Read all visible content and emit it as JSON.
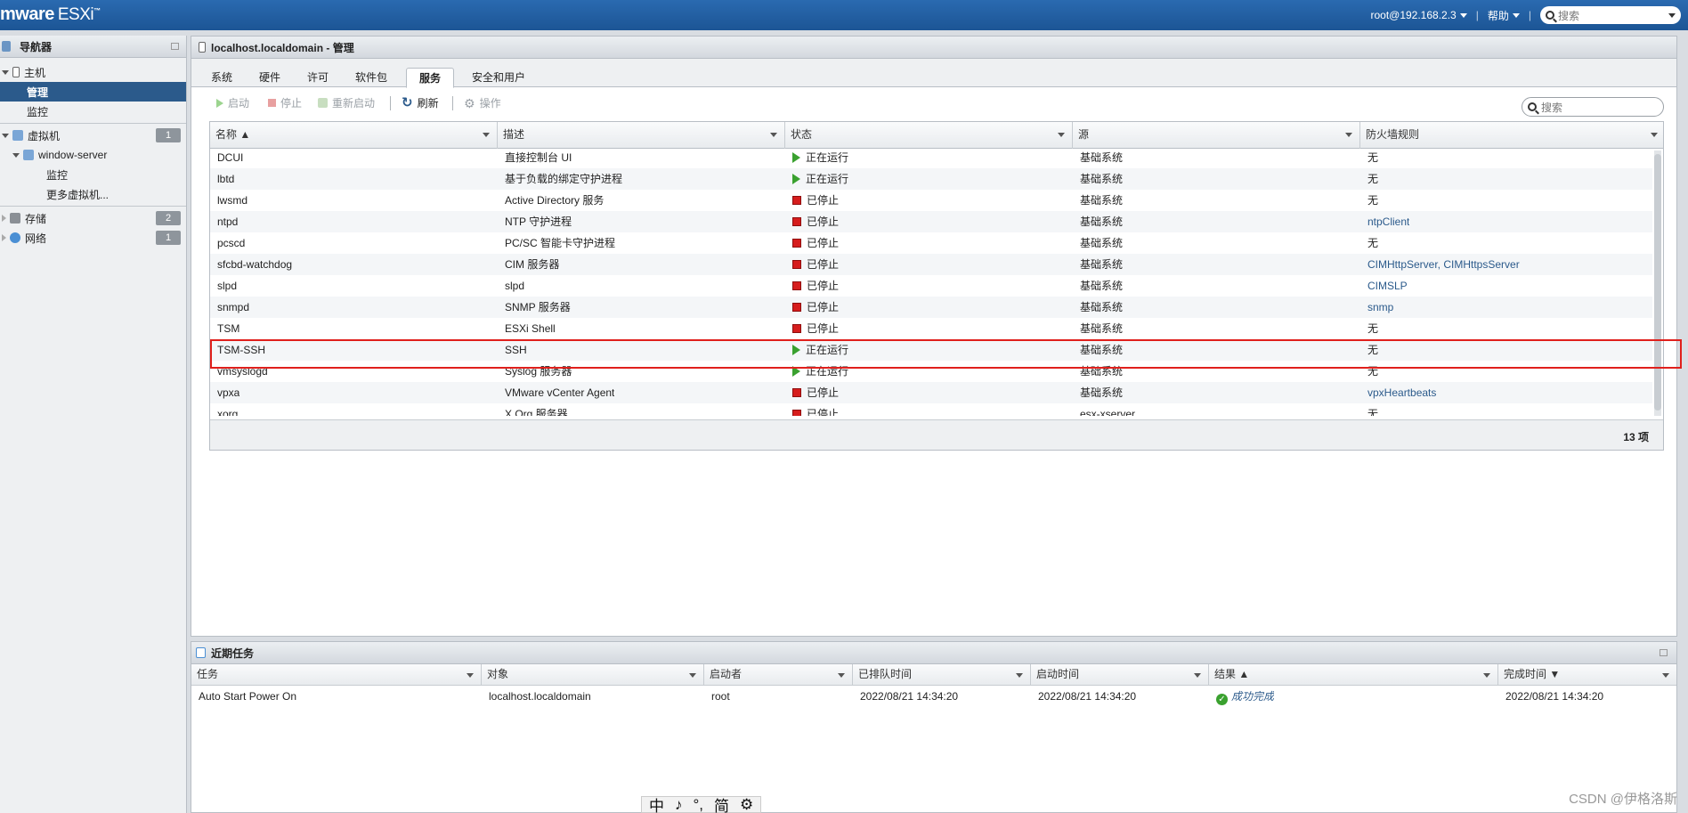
{
  "header": {
    "logo": "mware",
    "product": "ESXi",
    "user": "root@192.168.2.3",
    "help": "帮助",
    "sep": "|",
    "search_placeholder": "搜索"
  },
  "navigator": {
    "title": "导航器",
    "items": [
      {
        "label": "主机"
      },
      {
        "label": "管理"
      },
      {
        "label": "监控"
      },
      {
        "label": "虚拟机",
        "badge": "1"
      },
      {
        "label": "window-server"
      },
      {
        "label": "监控"
      },
      {
        "label": "更多虚拟机..."
      },
      {
        "label": "存储",
        "badge": "2"
      },
      {
        "label": "网络",
        "badge": "1"
      }
    ]
  },
  "main": {
    "title": "localhost.localdomain - 管理",
    "tabs": [
      "系统",
      "硬件",
      "许可",
      "软件包",
      "服务",
      "安全和用户"
    ],
    "toolbar": {
      "start": "启动",
      "stop": "停止",
      "restart": "重新启动",
      "refresh": "刷新",
      "actions": "操作"
    },
    "search_placeholder": "搜索",
    "columns": [
      "名称 ▲",
      "描述",
      "状态",
      "源",
      "防火墙规则"
    ],
    "rows": [
      {
        "name": "DCUI",
        "desc": "直接控制台 UI",
        "state": "正在运行",
        "running": true,
        "source": "基础系统",
        "fw": "无",
        "fw_link": false
      },
      {
        "name": "lbtd",
        "desc": "基于负载的绑定守护进程",
        "state": "正在运行",
        "running": true,
        "source": "基础系统",
        "fw": "无",
        "fw_link": false
      },
      {
        "name": "lwsmd",
        "desc": "Active Directory 服务",
        "state": "已停止",
        "running": false,
        "source": "基础系统",
        "fw": "无",
        "fw_link": false
      },
      {
        "name": "ntpd",
        "desc": "NTP 守护进程",
        "state": "已停止",
        "running": false,
        "source": "基础系统",
        "fw": "ntpClient",
        "fw_link": true
      },
      {
        "name": "pcscd",
        "desc": "PC/SC 智能卡守护进程",
        "state": "已停止",
        "running": false,
        "source": "基础系统",
        "fw": "无",
        "fw_link": false
      },
      {
        "name": "sfcbd-watchdog",
        "desc": "CIM 服务器",
        "state": "已停止",
        "running": false,
        "source": "基础系统",
        "fw": "CIMHttpServer, CIMHttpsServer",
        "fw_link": true
      },
      {
        "name": "slpd",
        "desc": "slpd",
        "state": "已停止",
        "running": false,
        "source": "基础系统",
        "fw": "CIMSLP",
        "fw_link": true
      },
      {
        "name": "snmpd",
        "desc": "SNMP 服务器",
        "state": "已停止",
        "running": false,
        "source": "基础系统",
        "fw": "snmp",
        "fw_link": true
      },
      {
        "name": "TSM",
        "desc": "ESXi Shell",
        "state": "已停止",
        "running": false,
        "source": "基础系统",
        "fw": "无",
        "fw_link": false
      },
      {
        "name": "TSM-SSH",
        "desc": "SSH",
        "state": "正在运行",
        "running": true,
        "source": "基础系统",
        "fw": "无",
        "fw_link": false
      },
      {
        "name": "vmsyslogd",
        "desc": "Syslog 服务器",
        "state": "正在运行",
        "running": true,
        "source": "基础系统",
        "fw": "无",
        "fw_link": false
      },
      {
        "name": "vpxa",
        "desc": "VMware vCenter Agent",
        "state": "已停止",
        "running": false,
        "source": "基础系统",
        "fw": "vpxHeartbeats",
        "fw_link": true
      },
      {
        "name": "xorg",
        "desc": "X.Org 服务器",
        "state": "已停止",
        "running": false,
        "source": "esx-xserver",
        "fw": "无",
        "fw_link": false
      }
    ],
    "count": "13 项"
  },
  "tasks": {
    "title": "近期任务",
    "columns": [
      "任务",
      "对象",
      "启动者",
      "已排队时间",
      "启动时间",
      "结果 ▲",
      "完成时间 ▼"
    ],
    "rows": [
      {
        "task": "Auto Start Power On",
        "target": "localhost.localdomain",
        "initiator": "root",
        "queued": "2022/08/21 14:34:20",
        "started": "2022/08/21 14:34:20",
        "result": "成功完成",
        "completed": "2022/08/21 14:34:20"
      }
    ]
  },
  "ime": [
    "中",
    "♪",
    "°,",
    "简",
    "⚙"
  ],
  "watermark": "CSDN @伊格洛斯",
  "colors": {
    "accent": "#2b5a8b",
    "running": "#3aa12f",
    "stopped": "#d61d1d",
    "highlight": "#e0201c"
  }
}
